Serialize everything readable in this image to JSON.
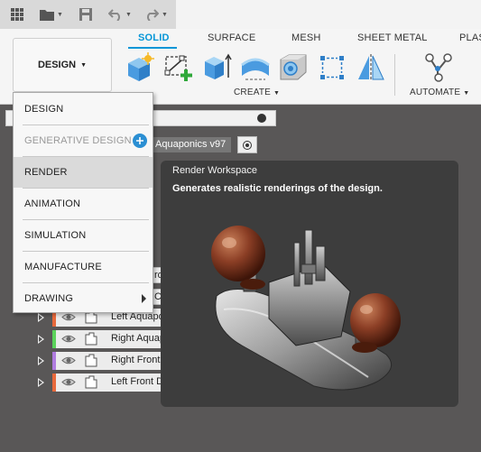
{
  "titlebar": {
    "icons": [
      "grid-icon",
      "folder-icon",
      "save-icon",
      "undo-icon",
      "redo-icon"
    ]
  },
  "ribbon": {
    "workspace_button": "DESIGN",
    "tabs": [
      {
        "label": "SOLID",
        "active": true
      },
      {
        "label": "SURFACE",
        "active": false
      },
      {
        "label": "MESH",
        "active": false
      },
      {
        "label": "SHEET METAL",
        "active": false
      },
      {
        "label": "PLAS",
        "active": false
      }
    ],
    "groups": {
      "create": "CREATE",
      "automate": "AUTOMATE"
    },
    "accent_color": "#0696d7"
  },
  "browser": {
    "document_name": "Aquaponics v97",
    "clipped_rows": [
      "ron",
      "Co"
    ],
    "rows": [
      {
        "label": "Left Aquaponic",
        "color": "#e8693c"
      },
      {
        "label": "Right Aquaponic",
        "color": "#5bd35b"
      },
      {
        "label": "Right Front",
        "color": "#b07ce0"
      },
      {
        "label": "Left Front D",
        "color": "#e8693c"
      }
    ]
  },
  "workspace_menu": {
    "items": [
      {
        "label": "DESIGN",
        "enabled": true
      },
      {
        "label": "GENERATIVE DESIGN",
        "enabled": false
      },
      {
        "label": "RENDER",
        "enabled": true,
        "highlighted": true
      },
      {
        "label": "ANIMATION",
        "enabled": true
      },
      {
        "label": "SIMULATION",
        "enabled": true
      },
      {
        "label": "MANUFACTURE",
        "enabled": true
      },
      {
        "label": "DRAWING",
        "enabled": true,
        "has_submenu": true
      }
    ]
  },
  "tooltip": {
    "title": "Render Workspace",
    "description": "Generates realistic renderings of the design."
  }
}
